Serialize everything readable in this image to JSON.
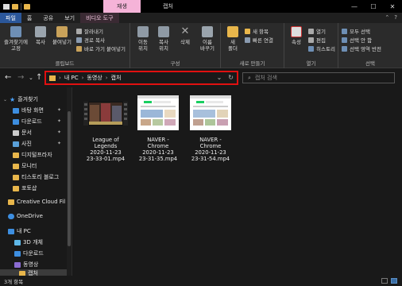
{
  "titlebar": {
    "context_tab": "재생",
    "title": "캡처",
    "minimize": "—",
    "maximize": "☐",
    "close": "✕"
  },
  "tabs": [
    "파일",
    "홈",
    "공유",
    "보기",
    "비디오 도구"
  ],
  "ribbon": {
    "clipboard": {
      "label": "클립보드",
      "pin": "즐겨찾기에\n고정",
      "copy": "복사",
      "paste": "붙여넣기",
      "cut": "잘라내기",
      "copy_path": "경로 복사",
      "paste_shortcut": "바로 가기 붙여넣기"
    },
    "organize": {
      "label": "구성",
      "move": "이동\n위치",
      "copyto": "복사\n위치",
      "delete": "삭제",
      "rename": "이름\n바꾸기"
    },
    "new": {
      "label": "새로 만들기",
      "folder": "새\n폴더",
      "new_item": "새 항목",
      "easy_access": "빠른 연결"
    },
    "open": {
      "label": "열기",
      "properties": "속성",
      "open": "열기",
      "edit": "편집",
      "history": "히스토리"
    },
    "select": {
      "label": "선택",
      "select_all": "모두 선택",
      "select_none": "선택 안 함",
      "invert": "선택 영역 반전"
    }
  },
  "address": {
    "segments": [
      "내 PC",
      "동영상",
      "캡처"
    ],
    "search_placeholder": "캡처 검색"
  },
  "nav": {
    "quick_access": "즐겨찾기",
    "items": [
      {
        "label": "바탕 화면",
        "pinned": true
      },
      {
        "label": "다운로드",
        "pinned": true
      },
      {
        "label": "문서",
        "pinned": true
      },
      {
        "label": "사진",
        "pinned": true
      },
      {
        "label": "디지털프라자",
        "pinned": false
      },
      {
        "label": "모니터",
        "pinned": false
      },
      {
        "label": "티스토리 블로그",
        "pinned": false
      },
      {
        "label": "포토샵",
        "pinned": false
      }
    ],
    "creative_cloud": "Creative Cloud Fil",
    "onedrive": "OneDrive",
    "this_pc": "내 PC",
    "pc_items": [
      "3D 개체",
      "다운로드",
      "동영상",
      "캡처"
    ]
  },
  "files": [
    {
      "name": "League of Legends 2020-11-23 23-33-01.mp4",
      "lines": [
        "League of",
        "Legends",
        "2020-11-23",
        "23-33-01.mp4"
      ]
    },
    {
      "name": "NAVER - Chrome 2020-11-23 23-31-35.mp4",
      "lines": [
        "NAVER -",
        "Chrome",
        "2020-11-23",
        "23-31-35.mp4"
      ]
    },
    {
      "name": "NAVER - Chrome 2020-11-23 23-31-54.mp4",
      "lines": [
        "NAVER -",
        "Chrome",
        "2020-11-23",
        "23-31-54.mp4"
      ]
    }
  ],
  "status": {
    "text": "3개 항목"
  },
  "colors": {
    "accent_tab": "#2b579a",
    "context_tab": "#f5b3d8",
    "address_highlight": "#e01010",
    "folder": "#e8b64b"
  }
}
